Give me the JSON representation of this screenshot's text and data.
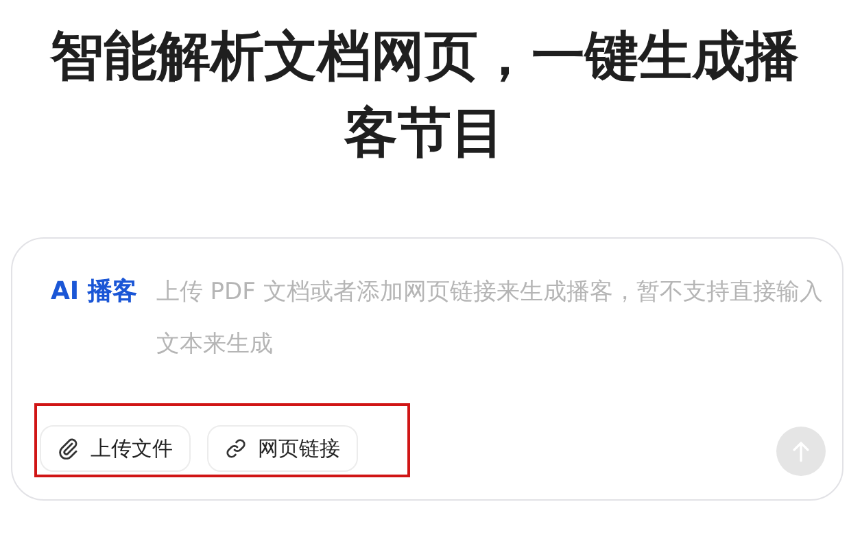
{
  "heading": "智能解析文档网页，一键生成播客节目",
  "composer": {
    "mode_label": "AI 播客",
    "placeholder": "上传 PDF 文档或者添加网页链接来生成播客，暂不支持直接输入文本来生成",
    "buttons": [
      {
        "kind": "upload",
        "label": "上传文件"
      },
      {
        "kind": "link",
        "label": "网页链接"
      }
    ],
    "send_disabled": true
  }
}
